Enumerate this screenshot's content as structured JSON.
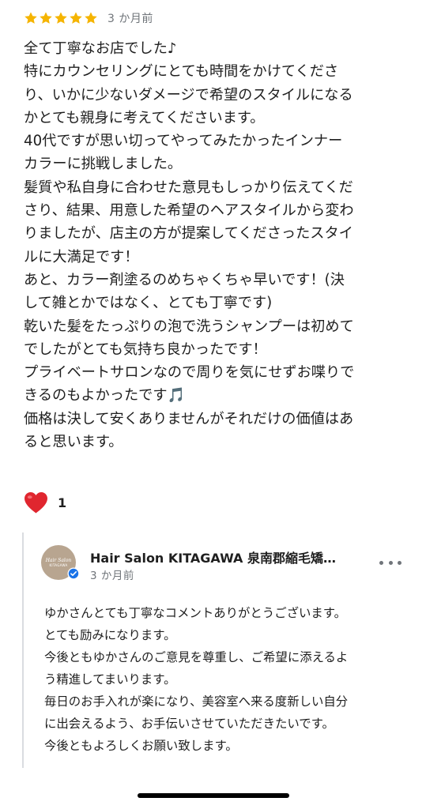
{
  "review": {
    "rating": 5,
    "star_color": "#f5b400",
    "star_icon": "star-icon",
    "date": "3 か月前",
    "body_lines": [
      "全て丁寧なお店でした♪",
      "特にカウンセリングにとても時間をかけてくださ",
      "り、いかに少ないダメージで希望のスタイルになる",
      "かとても親身に考えてくださいます。",
      "40代ですが思い切ってやってみたかったインナー",
      "カラーに挑戦しました。",
      "髪質や私自身に合わせた意見もしっかり伝えてくだ",
      "さり、結果、用意した希望のヘアスタイルから変わ",
      "りましたが、店主の方が提案してくださったスタイ",
      "ルに大満足です！",
      "あと、カラー剤塗るのめちゃくちゃ早いです！(決",
      "して雑とかではなく、とても丁寧です)",
      "乾いた髪をたっぷりの泡で洗うシャンプーは初めて",
      "でしたがとても気持ち良かったです！",
      "プライベートサロンなので周りを気にせずお喋りで",
      "きるのもよかったです🎵",
      "価格は決して安くありませんがそれだけの価値はあ",
      "ると思います。"
    ]
  },
  "reactions": {
    "heart_icon": "heart-icon",
    "heart_color": "#e0262f",
    "count": "1"
  },
  "owner_reply": {
    "name": "Hair Salon KITAGAWA 泉南郡縮毛矯…",
    "date": "3 か月前",
    "avatar_text_script": "Hair Salon",
    "avatar_text_brand": "KITAGAWA",
    "avatar_color": "#b8a590",
    "verified_color": "#1a73e8",
    "body_lines": [
      "ゆかさんとても丁寧なコメントありがとうございます。",
      "とても励みになります。",
      "今後ともゆかさんのご意見を尊重し、ご希望に添えるよ",
      "う精進してまいります。",
      "毎日のお手入れが楽になり、美容室へ来る度新しい自分",
      "に出会えるよう、お手伝いさせていただきたいです。",
      "今後ともよろしくお願い致します。"
    ]
  }
}
